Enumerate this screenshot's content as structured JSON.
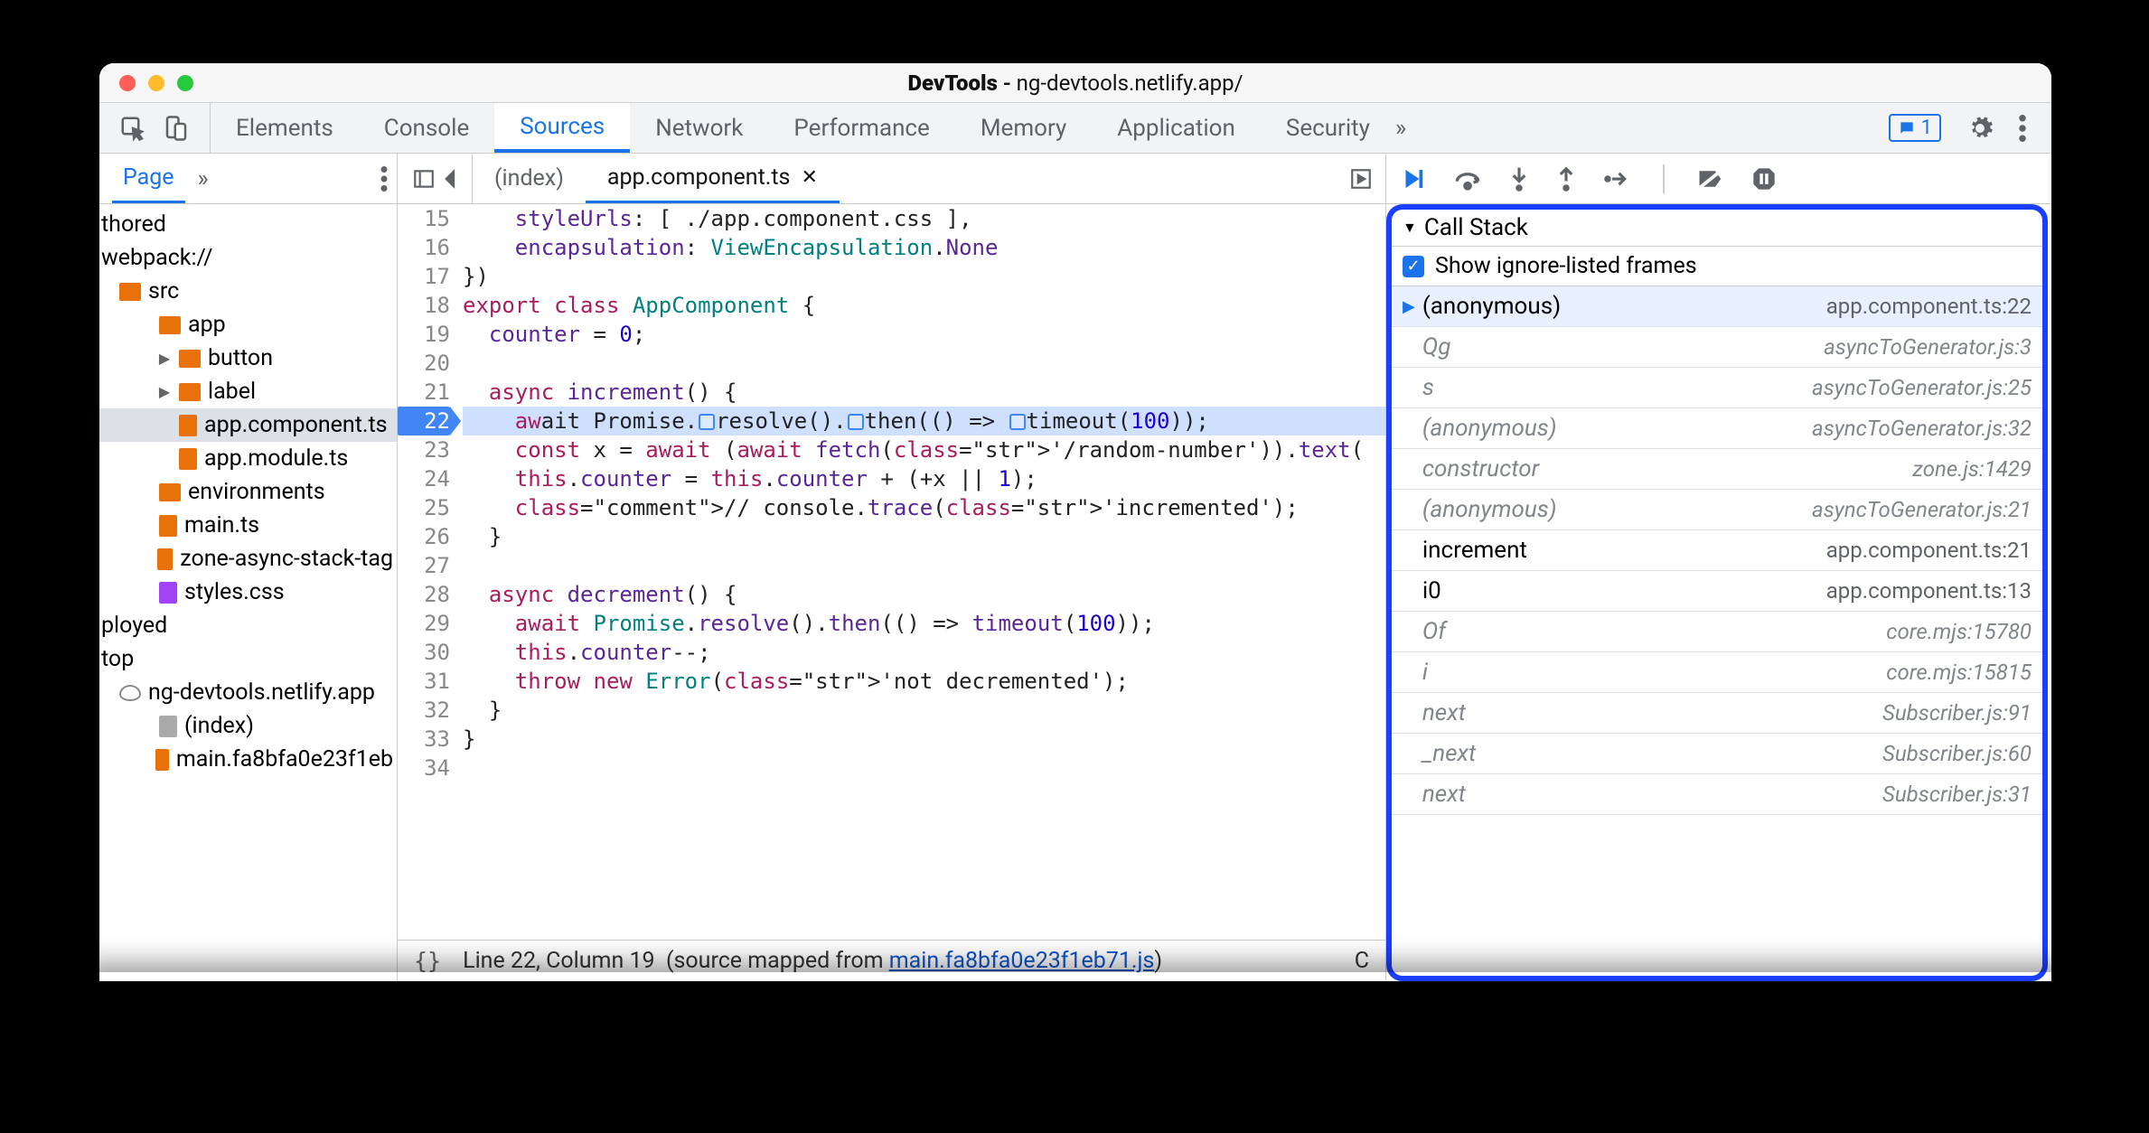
{
  "window": {
    "title_app": "DevTools",
    "title_path": "ng-devtools.netlify.app/"
  },
  "tabs": {
    "items": [
      "Elements",
      "Console",
      "Sources",
      "Network",
      "Performance",
      "Memory",
      "Application",
      "Security"
    ],
    "active": "Sources",
    "more": "»",
    "issues_count": "1"
  },
  "sidebar": {
    "tabs": {
      "active": "Page",
      "more": "»"
    },
    "tree": [
      {
        "depth": 0,
        "kind": "text",
        "label": "thored"
      },
      {
        "depth": 0,
        "kind": "text",
        "label": "webpack://"
      },
      {
        "depth": 1,
        "kind": "folder",
        "label": "src"
      },
      {
        "depth": 2,
        "kind": "folder",
        "label": "app"
      },
      {
        "depth": 3,
        "kind": "folder",
        "caret": "▶",
        "label": "button"
      },
      {
        "depth": 3,
        "kind": "folder",
        "caret": "▶",
        "label": "label"
      },
      {
        "depth": 3,
        "kind": "file",
        "label": "app.component.ts",
        "selected": true
      },
      {
        "depth": 3,
        "kind": "file",
        "label": "app.module.ts"
      },
      {
        "depth": 2,
        "kind": "folder",
        "label": "environments"
      },
      {
        "depth": 2,
        "kind": "file",
        "label": "main.ts"
      },
      {
        "depth": 2,
        "kind": "file",
        "label": "zone-async-stack-tag"
      },
      {
        "depth": 2,
        "kind": "file-purple",
        "label": "styles.css"
      },
      {
        "depth": 0,
        "kind": "text",
        "label": "ployed"
      },
      {
        "depth": 0,
        "kind": "text",
        "label": "top"
      },
      {
        "depth": 1,
        "kind": "cloud",
        "label": "ng-devtools.netlify.app"
      },
      {
        "depth": 2,
        "kind": "file-gray",
        "label": "(index)"
      },
      {
        "depth": 2,
        "kind": "file",
        "label": "main.fa8bfa0e23f1eb"
      }
    ]
  },
  "editor": {
    "tabs": [
      {
        "label": "(index)",
        "active": false,
        "close": false
      },
      {
        "label": "app.component.ts",
        "active": true,
        "close": true
      }
    ],
    "first_line": 15,
    "exec_line": 22,
    "code_lines": [
      {
        "n": 15,
        "html": "    styleUrls: [ ./app.component.css ],"
      },
      {
        "n": 16,
        "html": "    encapsulation: ViewEncapsulation.None"
      },
      {
        "n": 17,
        "html": "})"
      },
      {
        "n": 18,
        "html": "export class AppComponent {"
      },
      {
        "n": 19,
        "html": "  counter = 0;"
      },
      {
        "n": 20,
        "html": ""
      },
      {
        "n": 21,
        "html": "  async increment() {"
      },
      {
        "n": 22,
        "html": "    await Promise.resolve().then(() => timeout(100));"
      },
      {
        "n": 23,
        "html": "    const x = await (await fetch('/random-number')).text("
      },
      {
        "n": 24,
        "html": "    this.counter = this.counter + (+x || 1);"
      },
      {
        "n": 25,
        "html": "    // console.trace('incremented');"
      },
      {
        "n": 26,
        "html": "  }"
      },
      {
        "n": 27,
        "html": ""
      },
      {
        "n": 28,
        "html": "  async decrement() {"
      },
      {
        "n": 29,
        "html": "    await Promise.resolve().then(() => timeout(100));"
      },
      {
        "n": 30,
        "html": "    this.counter--;"
      },
      {
        "n": 31,
        "html": "    throw new Error('not decremented');"
      },
      {
        "n": 32,
        "html": "  }"
      },
      {
        "n": 33,
        "html": "}"
      },
      {
        "n": 34,
        "html": ""
      }
    ],
    "status": {
      "pos": "Line 22, Column 19",
      "mapped_prefix": "(source mapped from ",
      "mapped_file": "main.fa8bfa0e23f1eb71.js",
      "mapped_suffix": ")",
      "coverage": "C"
    }
  },
  "debugger": {
    "section": "Call Stack",
    "ignore_label": "Show ignore-listed frames",
    "frames": [
      {
        "fn": "(anonymous)",
        "loc": "app.component.ts:22",
        "current": true,
        "ignored": false
      },
      {
        "fn": "Qg",
        "loc": "asyncToGenerator.js:3",
        "ignored": true
      },
      {
        "fn": "s",
        "loc": "asyncToGenerator.js:25",
        "ignored": true
      },
      {
        "fn": "(anonymous)",
        "loc": "asyncToGenerator.js:32",
        "ignored": true
      },
      {
        "fn": "constructor",
        "loc": "zone.js:1429",
        "ignored": true
      },
      {
        "fn": "(anonymous)",
        "loc": "asyncToGenerator.js:21",
        "ignored": true
      },
      {
        "fn": "increment",
        "loc": "app.component.ts:21",
        "ignored": false
      },
      {
        "fn": "i0",
        "loc": "app.component.ts:13",
        "ignored": false
      },
      {
        "fn": "Of",
        "loc": "core.mjs:15780",
        "ignored": true
      },
      {
        "fn": "i",
        "loc": "core.mjs:15815",
        "ignored": true
      },
      {
        "fn": "next",
        "loc": "Subscriber.js:91",
        "ignored": true
      },
      {
        "fn": "_next",
        "loc": "Subscriber.js:60",
        "ignored": true
      },
      {
        "fn": "next",
        "loc": "Subscriber.js:31",
        "ignored": true
      }
    ]
  }
}
